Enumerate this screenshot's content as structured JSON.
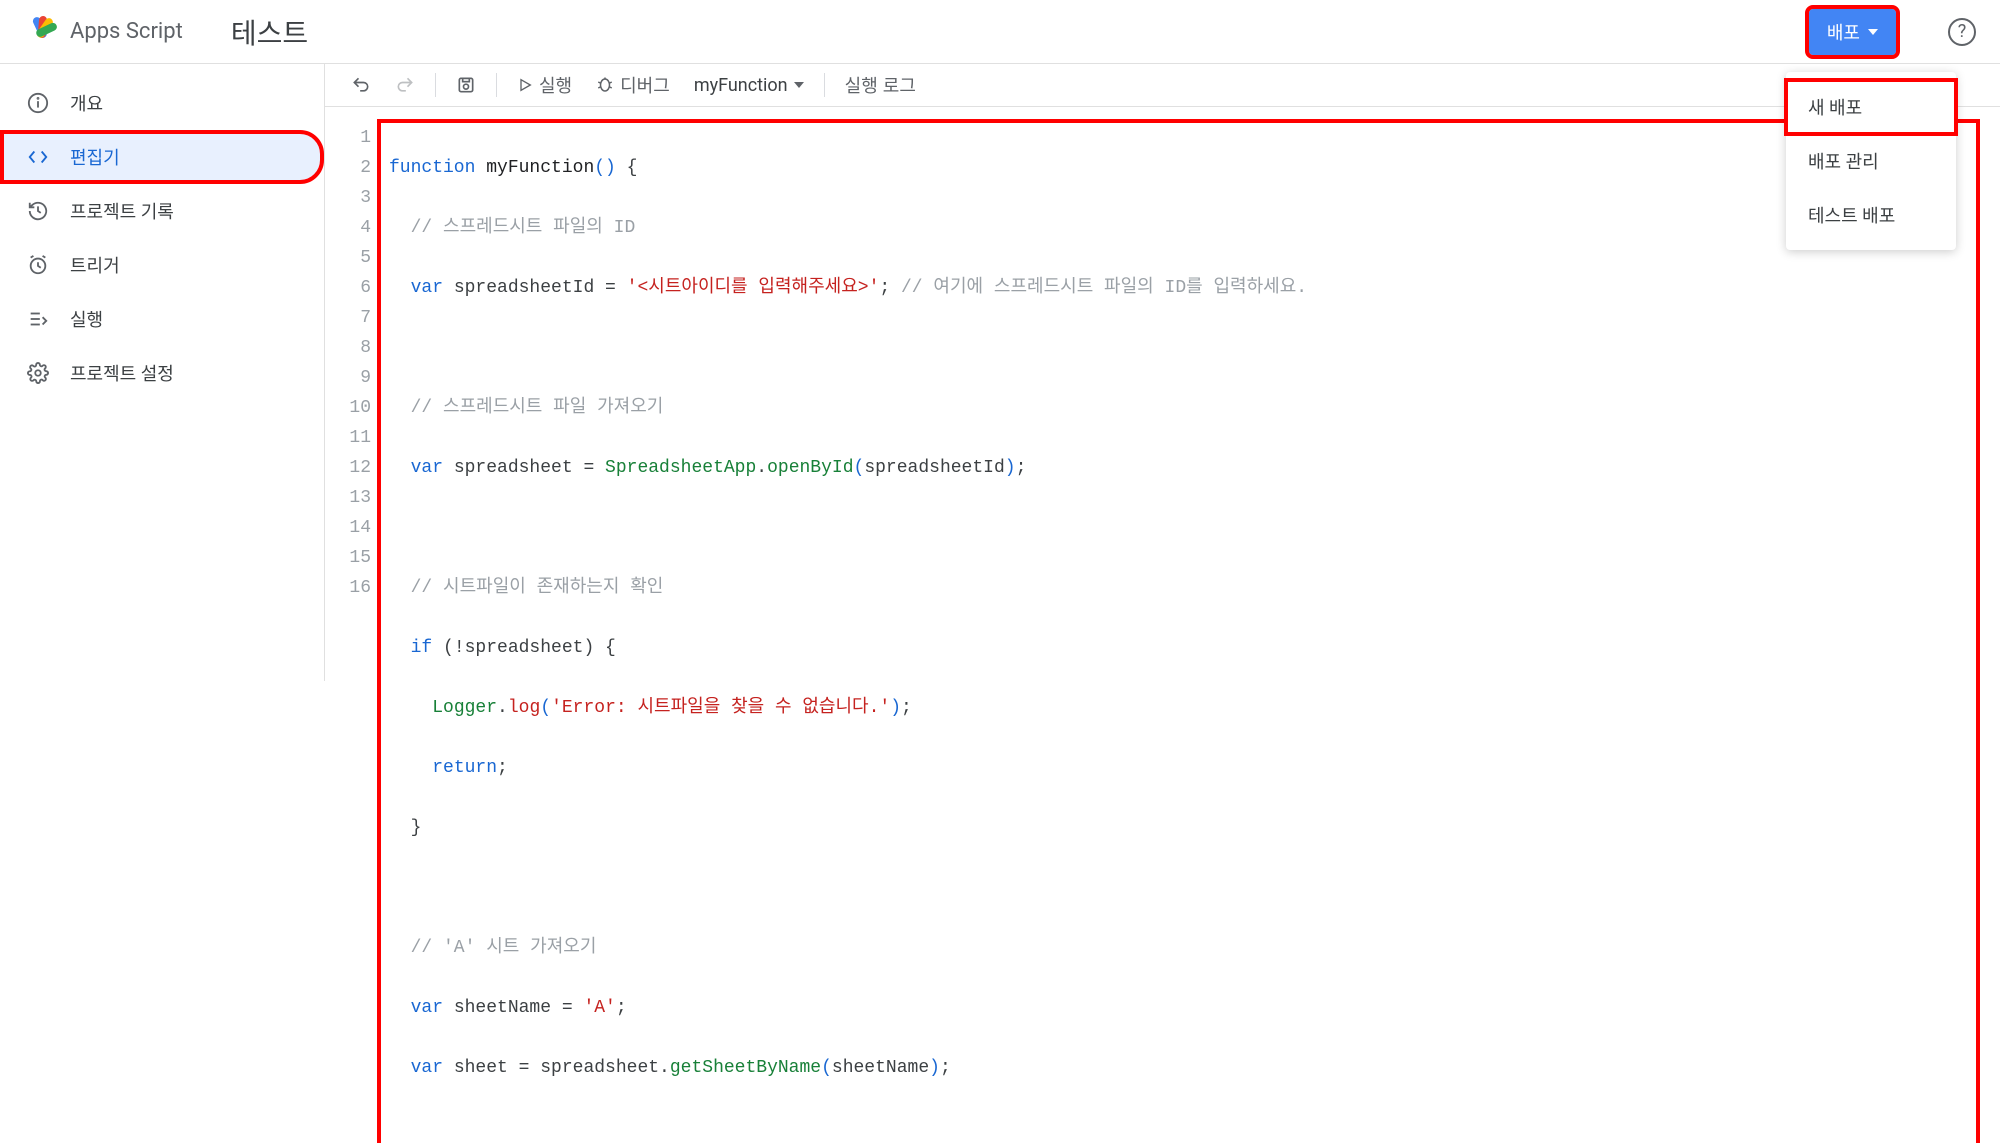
{
  "header": {
    "logo_text": "Apps Script",
    "project_title": "테스트",
    "deploy_label": "배포",
    "help_label": "?"
  },
  "sidebar": {
    "items": [
      {
        "label": "개요"
      },
      {
        "label": "편집기"
      },
      {
        "label": "프로젝트 기록"
      },
      {
        "label": "트리거"
      },
      {
        "label": "실행"
      },
      {
        "label": "프로젝트 설정"
      }
    ]
  },
  "toolbar": {
    "run_label": "실행",
    "debug_label": "디버그",
    "function_name": "myFunction",
    "exec_log_label": "실행 로그"
  },
  "dropdown": {
    "new_deploy": "새 배포",
    "manage_deploy": "배포 관리",
    "test_deploy": "테스트 배포"
  },
  "code": {
    "line_numbers": [
      "1",
      "2",
      "3",
      "4",
      "5",
      "6",
      "7",
      "8",
      "9",
      "10",
      "11",
      "12",
      "13",
      "14",
      "15",
      "16"
    ],
    "l1_kw": "function",
    "l1_fn": " myFunction",
    "l1_paren": "()",
    "l1_brace": " {",
    "l2_cmt": "  // 스프레드시트 파일의 ID",
    "l3_var": "  var",
    "l3_name": " spreadsheetId = ",
    "l3_str": "'<시트아이디를 입력해주세요>'",
    "l3_semi": ";",
    "l3_cmt": " // 여기에 스프레드시트 파일의 ID를 입력하세요.",
    "l5_cmt": "  // 스프레드시트 파일 가져오기",
    "l6_var": "  var",
    "l6_name": " spreadsheet = ",
    "l6_cls": "SpreadsheetApp",
    "l6_dot1": ".",
    "l6_method": "openById",
    "l6_open": "(",
    "l6_arg": "spreadsheetId",
    "l6_close": ")",
    "l6_semi": ";",
    "l8_cmt": "  // 시트파일이 존재하는지 확인",
    "l9_if": "  if",
    "l9_rest": " (!spreadsheet) {",
    "l10_indent": "    ",
    "l10_logger": "Logger",
    "l10_dot": ".",
    "l10_log": "log",
    "l10_open": "(",
    "l10_str": "'Error: 시트파일을 찾을 수 없습니다.'",
    "l10_close": ")",
    "l10_semi": ";",
    "l11_indent": "    ",
    "l11_return": "return",
    "l11_semi": ";",
    "l12_brace": "  }",
    "l14_cmt": "  // 'A' 시트 가져오기",
    "l15_var": "  var",
    "l15_name": " sheetName = ",
    "l15_str": "'A'",
    "l15_semi": ";",
    "l16_var": "  var",
    "l16_name": " sheet = spreadsheet.",
    "l16_method": "getSheetByName",
    "l16_open": "(",
    "l16_arg": "sheetName",
    "l16_close": ")",
    "l16_semi": ";"
  }
}
